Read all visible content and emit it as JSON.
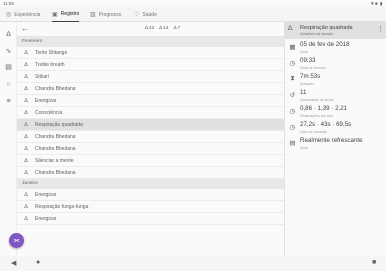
{
  "status_bar": {
    "time": "11:59",
    "system": "▼■ ▮"
  },
  "tabs": [
    {
      "label": "Experiência",
      "icon": "◎"
    },
    {
      "label": "Registro",
      "icon": "▣"
    },
    {
      "label": "Progresso",
      "icon": "▥"
    },
    {
      "label": "Saúde",
      "icon": "♡"
    }
  ],
  "rail_icons": [
    "∆",
    "∿",
    "▤",
    "○",
    "≡"
  ],
  "list_header": {
    "back_icon": "←",
    "counts": [
      {
        "icon": "∆",
        "value": "42"
      },
      {
        "icon": "∆",
        "value": "14"
      },
      {
        "icon": "∆",
        "value": "7"
      }
    ]
  },
  "sections": [
    {
      "title": "Fevereiro",
      "items": [
        {
          "label": "Tente Shtange",
          "selected": false
        },
        {
          "label": "Treble breath",
          "selected": false
        },
        {
          "label": "Sitkari",
          "selected": false
        },
        {
          "label": "Chandra Bhedana",
          "selected": false
        },
        {
          "label": "Energizar",
          "selected": false
        },
        {
          "label": "Consciência",
          "selected": false
        },
        {
          "label": "Respiração quadrada",
          "selected": true
        },
        {
          "label": "Chandra Bhedana",
          "selected": false
        },
        {
          "label": "Chandra Bhedana",
          "selected": false
        },
        {
          "label": "Silenciar a mente",
          "selected": false
        },
        {
          "label": "Chandra Bhedana",
          "selected": false
        }
      ]
    },
    {
      "title": "Janeiro",
      "items": [
        {
          "label": "Energizar",
          "selected": false
        },
        {
          "label": "Respiração funga-funga",
          "selected": false
        },
        {
          "label": "Energizar",
          "selected": false
        }
      ]
    }
  ],
  "detail": {
    "title": "Respiração quadrada",
    "subtitle": "Detalhes da sessão",
    "fields": [
      {
        "icon": "▦",
        "value": "05 de fev de 2018",
        "label": "Data"
      },
      {
        "icon": "◷",
        "value": "09:33",
        "label": "Hora de término"
      },
      {
        "icon": "⧗",
        "value": "7m 53s",
        "label": "Duração"
      },
      {
        "icon": "↺",
        "value": "11",
        "label": "Quantidade de ciclos"
      },
      {
        "icon": "◷",
        "value": "0,86 · 1,39 · 2,21",
        "label": "Respirações por min"
      },
      {
        "icon": "◷",
        "value": "27,2s · 43s · 69,5s",
        "label": "Ciclo de duração"
      },
      {
        "icon": "▤",
        "value": "Realmente refrescante",
        "label": "Nota"
      }
    ]
  },
  "fab": {
    "icon": "⫘"
  },
  "navbar": {
    "back": "◀",
    "home": "●",
    "recents": "■"
  }
}
